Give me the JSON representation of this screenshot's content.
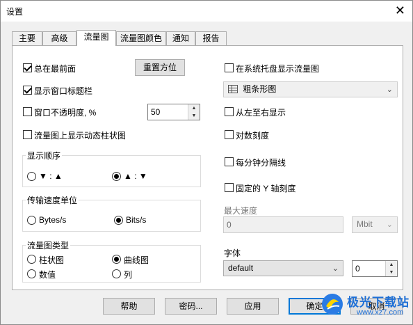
{
  "window": {
    "title": "设置",
    "close_glyph": "✕"
  },
  "tabs": [
    {
      "label": "主要",
      "active": false
    },
    {
      "label": "高级",
      "active": false
    },
    {
      "label": "流量图",
      "active": true
    },
    {
      "label": "流量图颜色",
      "active": false
    },
    {
      "label": "通知",
      "active": false
    },
    {
      "label": "报告",
      "active": false
    }
  ],
  "left": {
    "always_on_top": {
      "label": "总在最前面",
      "checked": true
    },
    "reset_position": "重置方位",
    "show_title_bar": {
      "label": "显示窗口标题栏",
      "checked": true
    },
    "opacity": {
      "label": "窗口不透明度, %",
      "checked": false,
      "value": "50"
    },
    "dynamic_bar": {
      "label": "流量图上显示动态柱状图",
      "checked": false
    },
    "display_order": {
      "title": "显示顺序",
      "opt1": "▼ : ▲",
      "opt2": "▲ : ▼",
      "selected": 2
    },
    "speed_unit": {
      "title": "传输速度单位",
      "opt1": "Bytes/s",
      "opt2": "Bits/s",
      "selected": 2
    },
    "graph_type": {
      "title": "流量图类型",
      "opt1": "柱状图",
      "opt2": "曲线图",
      "opt3": "数值",
      "opt4": "列",
      "selected": 2
    }
  },
  "right": {
    "tray_graph": {
      "label": "在系统托盘显示流量图",
      "checked": false
    },
    "bar_style": {
      "value": "粗条形图"
    },
    "left_to_right": {
      "label": "从左至右显示",
      "checked": false
    },
    "log_scale": {
      "label": "对数刻度",
      "checked": false
    },
    "minute_separator": {
      "label": "每分钟分隔线",
      "checked": false
    },
    "fixed_y": {
      "label": "固定的 Y 轴刻度",
      "checked": false
    },
    "max_speed": {
      "label": "最大速度",
      "value": "0",
      "unit": "Mbit"
    },
    "font": {
      "label": "字体",
      "value": "default",
      "size": "0"
    }
  },
  "buttons": {
    "help": "帮助",
    "password": "密码...",
    "apply": "应用",
    "ok": "确定",
    "cancel": "取消"
  },
  "watermark": {
    "brand": "极光下载站",
    "url": "www.xz7.com"
  },
  "icons": {
    "caret": "⌄",
    "spin_up": "▲",
    "spin_down": "▼"
  }
}
